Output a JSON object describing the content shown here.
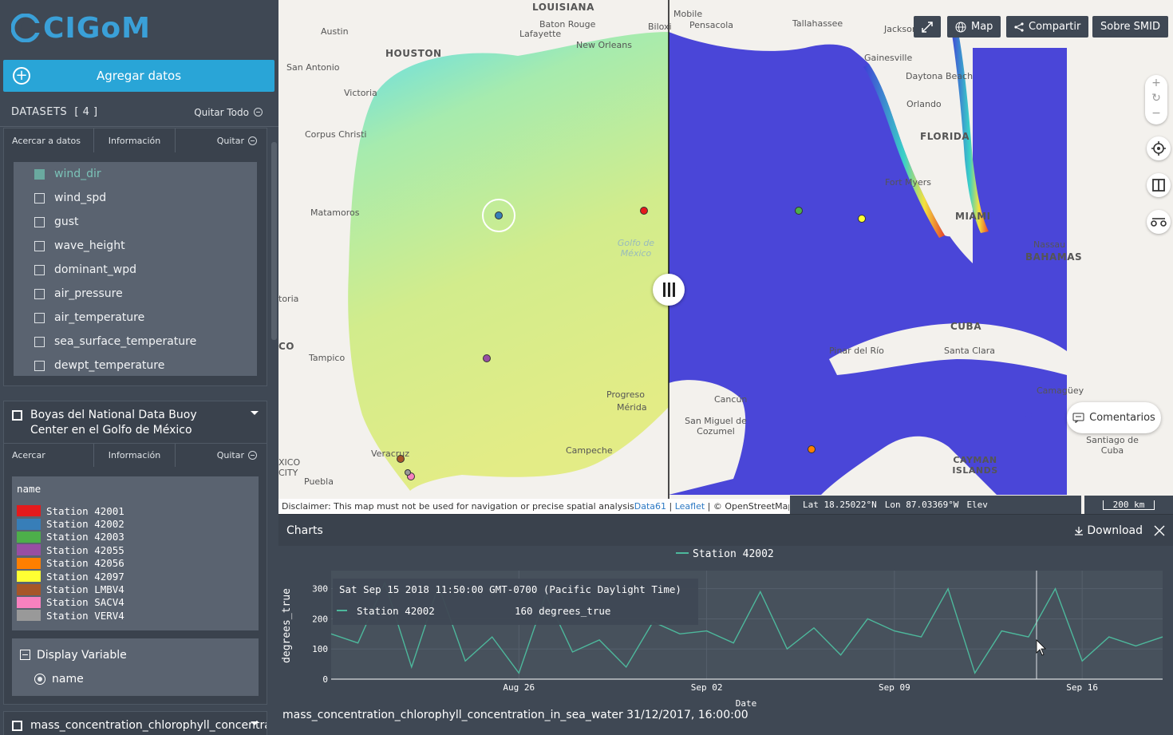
{
  "app": {
    "logo_text": "CIGoM"
  },
  "sidebar": {
    "add_data_label": "Agregar datos",
    "datasets_title": "DATASETS",
    "datasets_count": "[ 4 ]",
    "remove_all_label": "Quitar Todo",
    "dataset1": {
      "actions": [
        "Acercar a datos",
        "Información",
        "Quitar"
      ],
      "variables": [
        {
          "label": "wind_dir",
          "checked": true
        },
        {
          "label": "wind_spd",
          "checked": false
        },
        {
          "label": "gust",
          "checked": false
        },
        {
          "label": "wave_height",
          "checked": false
        },
        {
          "label": "dominant_wpd",
          "checked": false
        },
        {
          "label": "air_pressure",
          "checked": false
        },
        {
          "label": "air_temperature",
          "checked": false
        },
        {
          "label": "sea_surface_temperature",
          "checked": false
        },
        {
          "label": "dewpt_temperature",
          "checked": false
        }
      ]
    },
    "dataset2": {
      "title": "Boyas del National Data Buoy Center en el Golfo de México",
      "actions": [
        "Acercar",
        "Información",
        "Quitar"
      ],
      "legend_header": "name",
      "legend": [
        {
          "label": "Station 42001",
          "color": "#e41a1c"
        },
        {
          "label": "Station 42002",
          "color": "#377eb8"
        },
        {
          "label": "Station 42003",
          "color": "#4daf4a"
        },
        {
          "label": "Station 42055",
          "color": "#984ea3"
        },
        {
          "label": "Station 42056",
          "color": "#ff7f00"
        },
        {
          "label": "Station 42097",
          "color": "#ffff33"
        },
        {
          "label": "Station LMBV4",
          "color": "#a65628"
        },
        {
          "label": "Station SACV4",
          "color": "#f781bf"
        },
        {
          "label": "Station VERV4",
          "color": "#999999"
        }
      ],
      "display_variable_label": "Display Variable",
      "display_variable_option": "name"
    },
    "dataset3": {
      "title": "mass_concentration_chlorophyll_concentration_in_sea_water"
    }
  },
  "map": {
    "buttons": {
      "map": "Map",
      "share": "Compartir",
      "about": "Sobre SMID"
    },
    "comments_label": "Comentarios",
    "disclaimer": "Disclaimer: This map must not be used for navigation or precise spatial analysis",
    "attrib_data61": "Data61",
    "attrib_sep": " | ",
    "attrib_leaflet": "Leaflet",
    "attrib_osm": " | © OpenStreetMap contributors O",
    "lat": "Lat  18.25022°N",
    "lon": "Lon  87.03369°W",
    "elev": "Elev",
    "scale": "200 km",
    "place_labels": [
      "LOUISIANA",
      "Baton Rouge",
      "Lafayette",
      "New Orleans",
      "HOUSTON",
      "Austin",
      "San Antonio",
      "Victoria",
      "Corpus Christi",
      "Matamoros",
      "Tampico",
      "Veracruz",
      "Puebla",
      "Campeche",
      "Progreso",
      "Mérida",
      "Cancún",
      "San Miguel de Cozumel",
      "Mobile",
      "Pensacola",
      "Tallahassee",
      "Jackson",
      "Gainesville",
      "Daytona Beach",
      "Orlando",
      "FLORIDA",
      "Fort Myers",
      "MIAMI",
      "Nassau",
      "BAHAMAS",
      "Pinar del Río",
      "Santa Clara",
      "CUBA",
      "Camagüey",
      "CAYMAN ISLANDS",
      "Santiago de Cuba",
      "Golfo de México",
      "Biloxi",
      "toria",
      "CO",
      "XICO CITY"
    ]
  },
  "charts": {
    "panel_title": "Charts",
    "download_label": "Download",
    "bottom_title": "mass_concentration_chlorophyll_concentration_in_sea_water 31/12/2017, 16:00:00",
    "tooltip_date": "Sat Sep 15 2018 11:50:00 GMT-0700 (Pacific Daylight Time)",
    "tooltip_series": "Station 42002",
    "tooltip_value": "160 degrees_true"
  },
  "chart_data": {
    "type": "line",
    "title": "",
    "xlabel": "Date",
    "ylabel": "degrees_true",
    "ylim": [
      0,
      360
    ],
    "xlim": [
      "2018-08-19",
      "2018-09-19"
    ],
    "x_ticks": [
      "Aug 26",
      "Sep 02",
      "Sep 09",
      "Sep 16"
    ],
    "y_ticks": [
      0,
      100,
      200,
      300
    ],
    "legend": "top-center",
    "series": [
      {
        "name": "Station 42002",
        "color": "#4db89c",
        "x": [
          "2018-08-19",
          "2018-08-20",
          "2018-08-21",
          "2018-08-22",
          "2018-08-23",
          "2018-08-24",
          "2018-08-25",
          "2018-08-26",
          "2018-08-27",
          "2018-08-28",
          "2018-08-29",
          "2018-08-30",
          "2018-08-31",
          "2018-09-01",
          "2018-09-02",
          "2018-09-03",
          "2018-09-04",
          "2018-09-05",
          "2018-09-06",
          "2018-09-07",
          "2018-09-08",
          "2018-09-09",
          "2018-09-10",
          "2018-09-11",
          "2018-09-12",
          "2018-09-13",
          "2018-09-14",
          "2018-09-15",
          "2018-09-16",
          "2018-09-17",
          "2018-09-18",
          "2018-09-19"
        ],
        "values": [
          150,
          120,
          320,
          40,
          310,
          60,
          140,
          20,
          280,
          90,
          130,
          40,
          190,
          150,
          160,
          120,
          290,
          100,
          170,
          80,
          200,
          160,
          140,
          300,
          20,
          160,
          140,
          300,
          60,
          140,
          110,
          140
        ]
      }
    ]
  }
}
